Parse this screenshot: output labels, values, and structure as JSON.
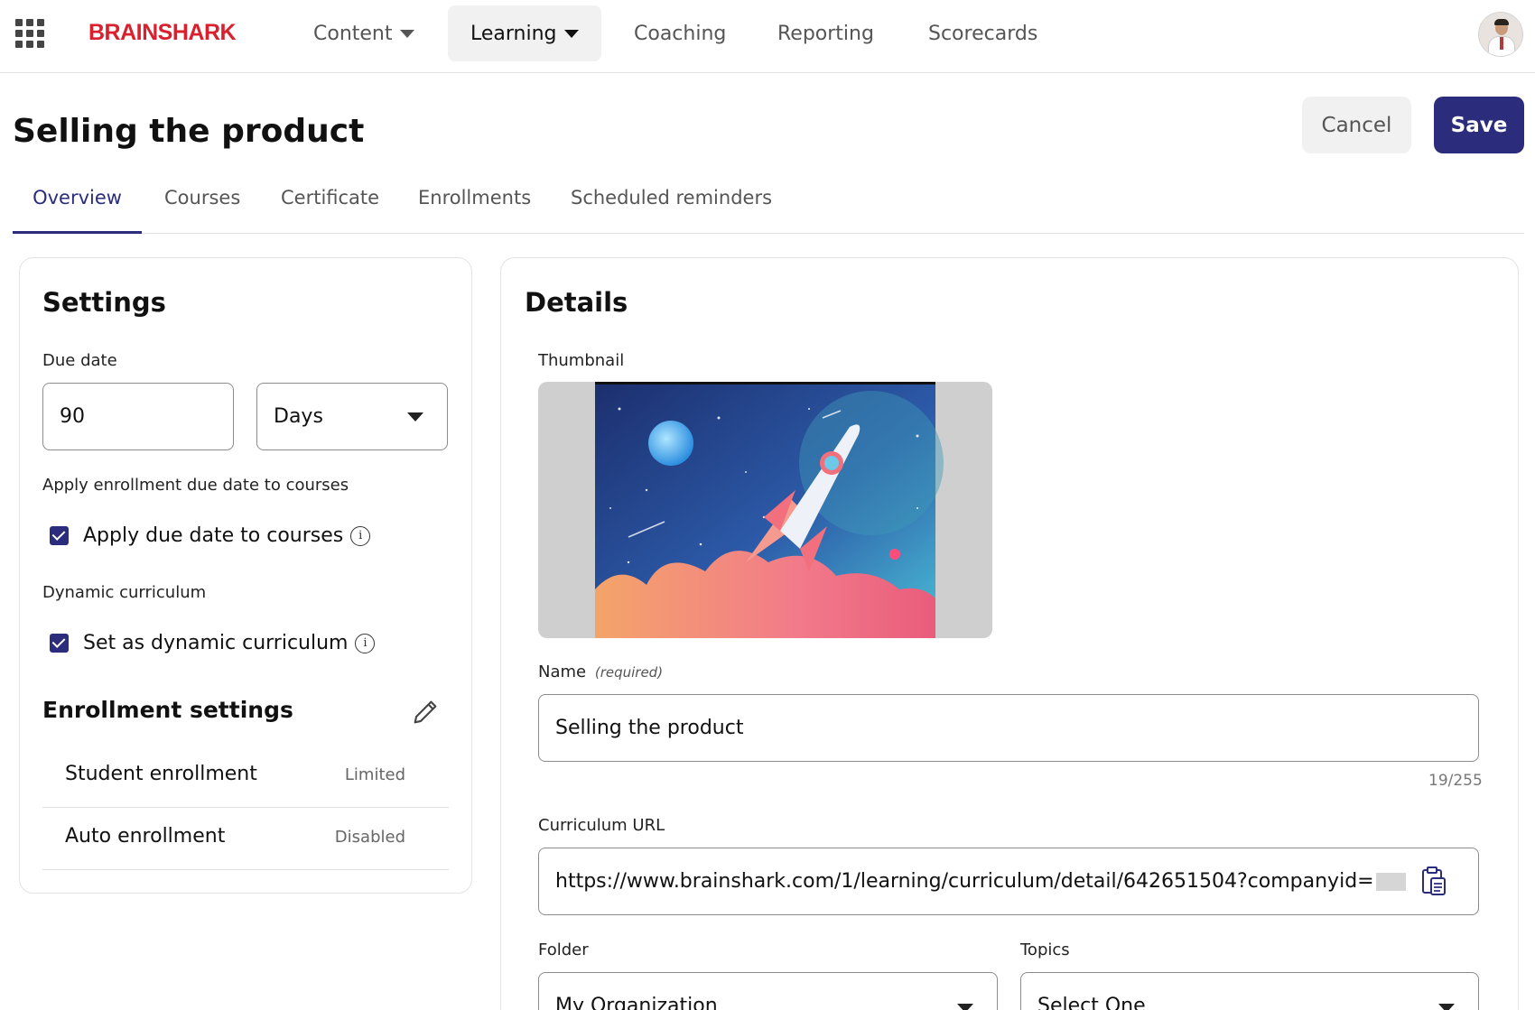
{
  "nav": {
    "logo": "BRAINSHARK",
    "items": [
      {
        "label": "Content"
      },
      {
        "label": "Learning"
      },
      {
        "label": "Coaching"
      },
      {
        "label": "Reporting"
      },
      {
        "label": "Scorecards"
      }
    ],
    "icons": {
      "apps": "apps-grid-icon",
      "avatar": "user-avatar"
    }
  },
  "header": {
    "title": "Selling the product",
    "cancel_label": "Cancel",
    "save_label": "Save"
  },
  "tabs": [
    {
      "label": "Overview",
      "active": true
    },
    {
      "label": "Courses"
    },
    {
      "label": "Certificate"
    },
    {
      "label": "Enrollments"
    },
    {
      "label": "Scheduled reminders"
    }
  ],
  "settings": {
    "title": "Settings",
    "due_date_label": "Due date",
    "due_date_value": "90",
    "due_date_unit": "Days",
    "apply_section_label": "Apply enrollment due date to courses",
    "apply_checkbox_label": "Apply due date to courses",
    "dynamic_section_label": "Dynamic curriculum",
    "dynamic_checkbox_label": "Set as dynamic curriculum",
    "enrollment_title": "Enrollment settings",
    "rows": [
      {
        "key": "Student enrollment",
        "value": "Limited"
      },
      {
        "key": "Auto enrollment",
        "value": "Disabled"
      }
    ]
  },
  "details": {
    "title": "Details",
    "thumbnail_label": "Thumbnail",
    "name_label": "Name",
    "name_required": "(required)",
    "name_value": "Selling the product",
    "name_counter": "19/255",
    "url_label": "Curriculum URL",
    "url_value": "https://www.brainshark.com/1/learning/curriculum/detail/642651504?companyid=",
    "folder_label": "Folder",
    "folder_value": "My Organization",
    "topics_label": "Topics",
    "topics_value": "Select One"
  },
  "colors": {
    "brand": "#d9202e",
    "accent": "#2b2d7c"
  }
}
